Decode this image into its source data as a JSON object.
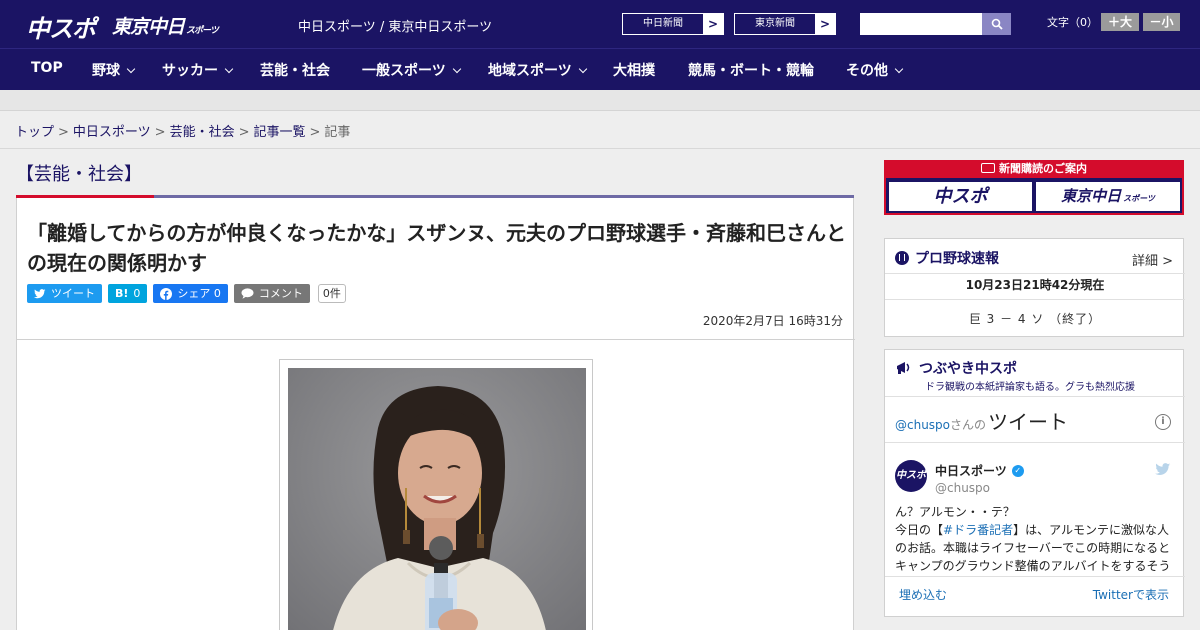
{
  "header": {
    "logo_main": "中スポ",
    "logo_tokyo": "東京中日",
    "logo_tokyo_small": "スポーツ",
    "site_links": "中日スポーツ / 東京中日スポーツ",
    "newspaper_buttons": [
      "中日新聞",
      "東京新聞"
    ],
    "search_placeholder": "",
    "font_size_label": "文字（0）",
    "font_larger": "＋大",
    "font_smaller": "－小"
  },
  "nav": {
    "items": [
      {
        "label": "TOP",
        "dropdown": false
      },
      {
        "label": "野球",
        "dropdown": true
      },
      {
        "label": "サッカー",
        "dropdown": true
      },
      {
        "label": "芸能・社会",
        "dropdown": false
      },
      {
        "label": "一般スポーツ",
        "dropdown": true
      },
      {
        "label": "地域スポーツ",
        "dropdown": true
      },
      {
        "label": "大相撲",
        "dropdown": false
      },
      {
        "label": "競馬・ボート・競輪",
        "dropdown": false
      },
      {
        "label": "その他",
        "dropdown": true
      }
    ]
  },
  "breadcrumb": {
    "items": [
      "トップ",
      "中日スポーツ",
      "芸能・社会",
      "記事一覧"
    ],
    "current": "記事",
    "separator": ">"
  },
  "article": {
    "category": "【芸能・社会】",
    "headline": "「離婚してからの方が仲良くなったかな」スザンヌ、元夫のプロ野球選手・斉藤和巳さんとの現在の関係明かす",
    "share": {
      "tweet": "ツイート",
      "hatena": "B!",
      "hatena_count": "0",
      "facebook": "シェア",
      "facebook_count": "0",
      "comment": "コメント",
      "comment_count": "0件"
    },
    "date": "2020年2月7日 16時31分"
  },
  "sidebar": {
    "subscription": {
      "heading": "新聞購読のご案内",
      "logo_a": "中スポ",
      "logo_b": "東京中日",
      "logo_b_small": "スポーツ"
    },
    "baseball": {
      "title": "プロ野球速報",
      "detail": "詳細 >",
      "as_of": "10月23日21時42分現在",
      "score": "巨 3 － 4 ソ （終了）"
    },
    "tweets": {
      "title": "つぶやき中スポ",
      "subtitle": "ドラ観戦の本紙評論家も語る。グラも熱烈応援",
      "handle_link": "@chuspo",
      "handle_suffix": "さんの",
      "heading": "ツイート",
      "account_name": "中日スポーツ",
      "account_handle": "@chuspo",
      "avatar_text": "中スポ",
      "text_line1": "ん？アルモン・・テ？",
      "text_pre": "今日の【",
      "text_hashtag": "#ドラ番記者",
      "text_post": "】は、アルモンテに激似な人のお話。本職はライフセーバーでこの時期になるとキャンプのグラウンド整備のアルバイトをするそう",
      "embed": "埋め込む",
      "view": "Twitterで表示"
    }
  },
  "colors": {
    "brand_navy": "#1b1464",
    "accent_red": "#d40c2c",
    "twitter_blue": "#1d9bf0",
    "facebook_blue": "#1877f2",
    "hatena_blue": "#00a4de"
  }
}
